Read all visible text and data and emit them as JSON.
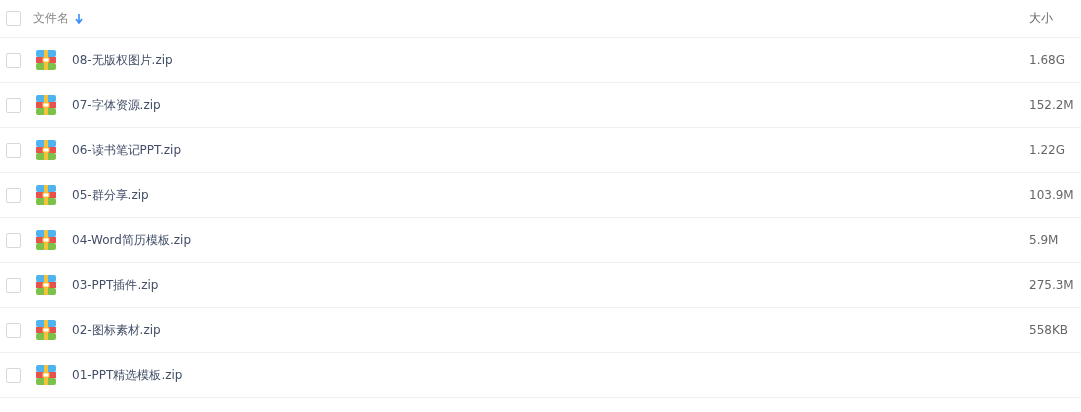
{
  "header": {
    "checked": false,
    "name_column": "文件名",
    "size_column": "大小"
  },
  "files": [
    {
      "name": "08-无版权图片.zip",
      "size": "1.68G",
      "checked": false
    },
    {
      "name": "07-字体资源.zip",
      "size": "152.2M",
      "checked": false
    },
    {
      "name": "06-读书笔记PPT.zip",
      "size": "1.22G",
      "checked": false
    },
    {
      "name": "05-群分享.zip",
      "size": "103.9M",
      "checked": false
    },
    {
      "name": "04-Word简历模板.zip",
      "size": "5.9M",
      "checked": false
    },
    {
      "name": "03-PPT插件.zip",
      "size": "275.3M",
      "checked": false
    },
    {
      "name": "02-图标素材.zip",
      "size": "558KB",
      "checked": false
    },
    {
      "name": "01-PPT精选模板.zip",
      "checked": false
    }
  ]
}
